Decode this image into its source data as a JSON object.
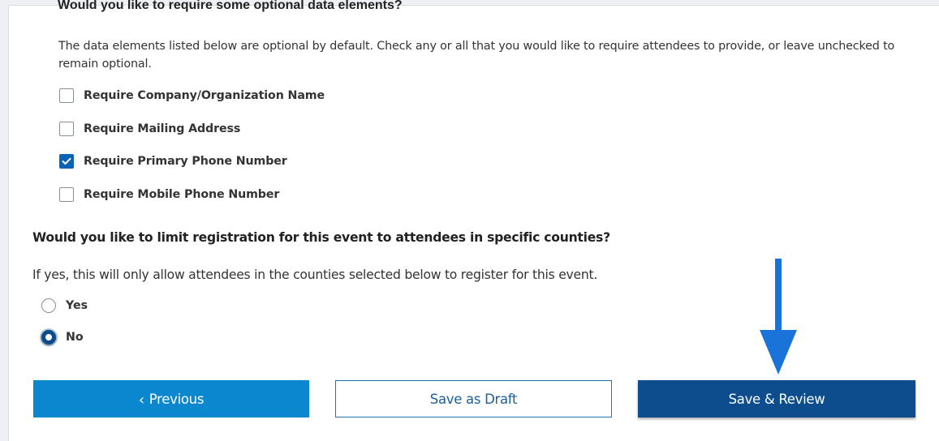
{
  "optional_section": {
    "heading": "Would you like to require some optional data elements?",
    "description": "The data elements listed below are optional by default. Check any or all that you would like to require attendees to provide, or leave unchecked to remain optional.",
    "options": [
      {
        "label": "Require Company/Organization Name",
        "checked": false
      },
      {
        "label": "Require Mailing Address",
        "checked": false
      },
      {
        "label": "Require Primary Phone Number",
        "checked": true
      },
      {
        "label": "Require Mobile Phone Number",
        "checked": false
      }
    ]
  },
  "county_section": {
    "question": "Would you like to limit registration for this event to attendees in specific counties?",
    "note": "If yes, this will only allow attendees in the counties selected below to register for this event.",
    "options": [
      {
        "label": "Yes",
        "selected": false
      },
      {
        "label": "No",
        "selected": true
      }
    ]
  },
  "buttons": {
    "previous": {
      "icon": "chevron-left-icon",
      "label": "Previous"
    },
    "draft": {
      "label": "Save as Draft"
    },
    "review": {
      "label": "Save & Review"
    }
  },
  "annotation": {
    "icon": "arrow-down-icon",
    "color": "#1a73d9"
  },
  "colors": {
    "primary_dark": "#0d4d8e",
    "primary_light": "#0a87cf",
    "checkbox_checked": "#0a63b5"
  }
}
